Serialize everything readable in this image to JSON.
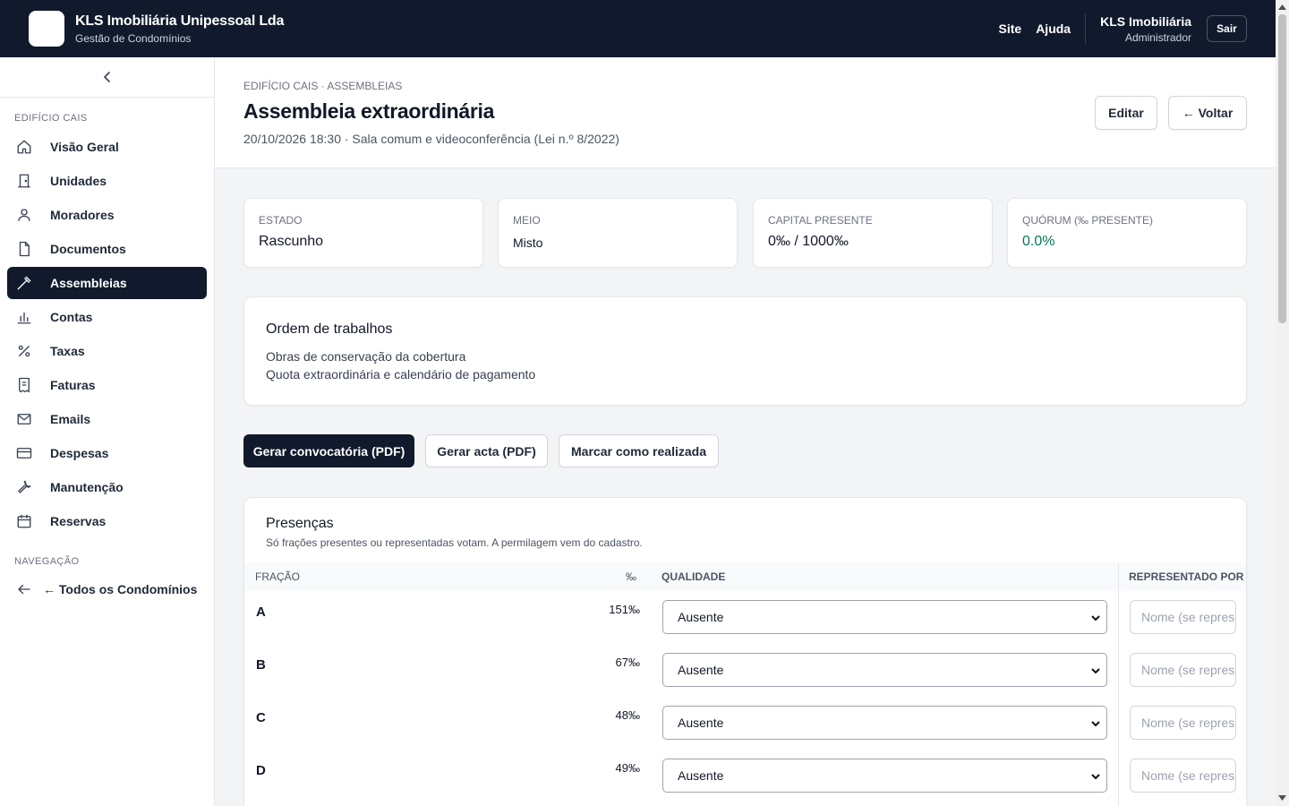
{
  "header": {
    "brand_name": "KLS Imobiliária Unipessoal Lda",
    "brand_sub": "Gestão de Condomínios",
    "links": [
      "Site",
      "Ajuda"
    ],
    "user_name": "KLS Imobiliária",
    "user_role": "Administrador",
    "logout_label": "Sair"
  },
  "sidebar": {
    "section_building": "EDIFÍCIO CAIS",
    "items": [
      {
        "label": "Visão Geral",
        "icon": "home-icon"
      },
      {
        "label": "Unidades",
        "icon": "door-icon"
      },
      {
        "label": "Moradores",
        "icon": "user-icon"
      },
      {
        "label": "Documentos",
        "icon": "document-icon"
      },
      {
        "label": "Assembleias",
        "icon": "gavel-icon",
        "active": true
      },
      {
        "label": "Contas",
        "icon": "bar-chart-icon"
      },
      {
        "label": "Taxas",
        "icon": "percent-icon"
      },
      {
        "label": "Faturas",
        "icon": "receipt-icon"
      },
      {
        "label": "Emails",
        "icon": "mail-icon"
      },
      {
        "label": "Despesas",
        "icon": "credit-card-icon"
      },
      {
        "label": "Manutenção",
        "icon": "wrench-icon"
      },
      {
        "label": "Reservas",
        "icon": "calendar-icon"
      }
    ],
    "section_nav": "NAVEGAÇÃO",
    "back_label": "← Todos os Condomínios"
  },
  "page": {
    "breadcrumb": "EDIFÍCIO CAIS · ASSEMBLEIAS",
    "title": "Assembleia extraordinária",
    "meta": "20/10/2026 18:30 · Sala comum e videoconferência (Lei n.º 8/2022)",
    "edit_label": "Editar",
    "back_label": "← Voltar"
  },
  "stats": [
    {
      "label": "ESTADO",
      "value": "Rascunho"
    },
    {
      "label": "MEIO",
      "value": "Misto"
    },
    {
      "label": "CAPITAL PRESENTE",
      "value": "0‰ / 1000‰"
    },
    {
      "label": "QUÓRUM (‰ PRESENTE)",
      "value": "0.0%"
    }
  ],
  "agenda": {
    "title": "Ordem de trabalhos",
    "items": [
      "Obras de conservação da cobertura",
      "Quota extraordinária e calendário de pagamento"
    ]
  },
  "actions": {
    "convocatoria": "Gerar convocatória (PDF)",
    "acta": "Gerar acta (PDF)",
    "realizada": "Marcar como realizada"
  },
  "presencas": {
    "title": "Presenças",
    "subtitle": "Só frações presentes ou representadas votam. A permilagem vem do cadastro.",
    "columns": {
      "fracao": "FRAÇÃO",
      "perm": "‰",
      "qualidade": "QUALIDADE",
      "representado": "REPRESENTADO POR"
    },
    "rep_placeholder": "Nome (se representado)",
    "rows": [
      {
        "fracao": "A",
        "perm": "151‰",
        "qualidade": "Ausente"
      },
      {
        "fracao": "B",
        "perm": "67‰",
        "qualidade": "Ausente"
      },
      {
        "fracao": "C",
        "perm": "48‰",
        "qualidade": "Ausente"
      },
      {
        "fracao": "D",
        "perm": "49‰",
        "qualidade": "Ausente"
      }
    ]
  },
  "colors": {
    "navy": "#111a2c",
    "green": "#047857"
  }
}
